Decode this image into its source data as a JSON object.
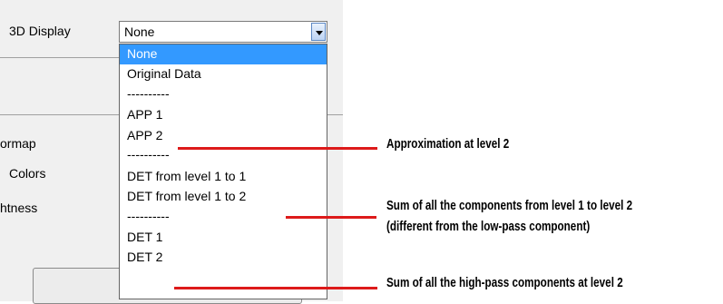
{
  "panel": {
    "field_label": "3D Display",
    "side_labels": [
      "ormap",
      "Colors",
      "htness"
    ]
  },
  "combo": {
    "value": "None",
    "options": [
      "None",
      "Original Data",
      "----------",
      "APP 1",
      "APP 2",
      "----------",
      "DET from level 1 to 1",
      "DET from level 1 to 2",
      "----------",
      "DET 1",
      "DET 2"
    ],
    "selected_index": 0
  },
  "annotations": {
    "app2": "Approximation at level 2",
    "det12_line1": "Sum of all the components from level 1 to level 2",
    "det12_line2": "(different from the low-pass component)",
    "det2": "Sum of all the high-pass components at level 2"
  },
  "colors": {
    "selection": "#3399ff",
    "annotation_line": "#dd1a1a"
  }
}
